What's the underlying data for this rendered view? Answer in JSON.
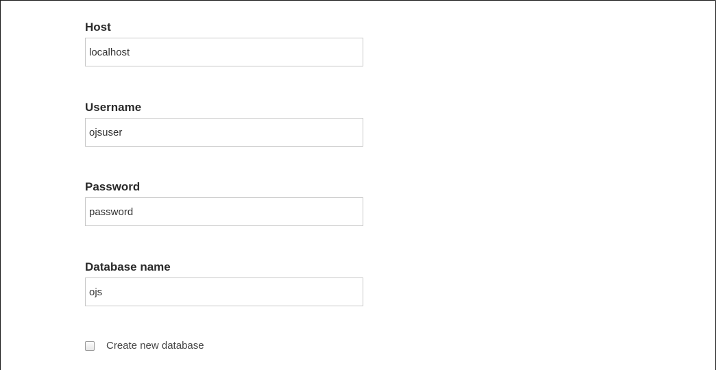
{
  "form": {
    "host": {
      "label": "Host",
      "value": "localhost"
    },
    "username": {
      "label": "Username",
      "value": "ojsuser"
    },
    "password": {
      "label": "Password",
      "value": "password"
    },
    "database_name": {
      "label": "Database name",
      "value": "ojs"
    },
    "create_new_database": {
      "label": "Create new database",
      "checked": false
    }
  }
}
